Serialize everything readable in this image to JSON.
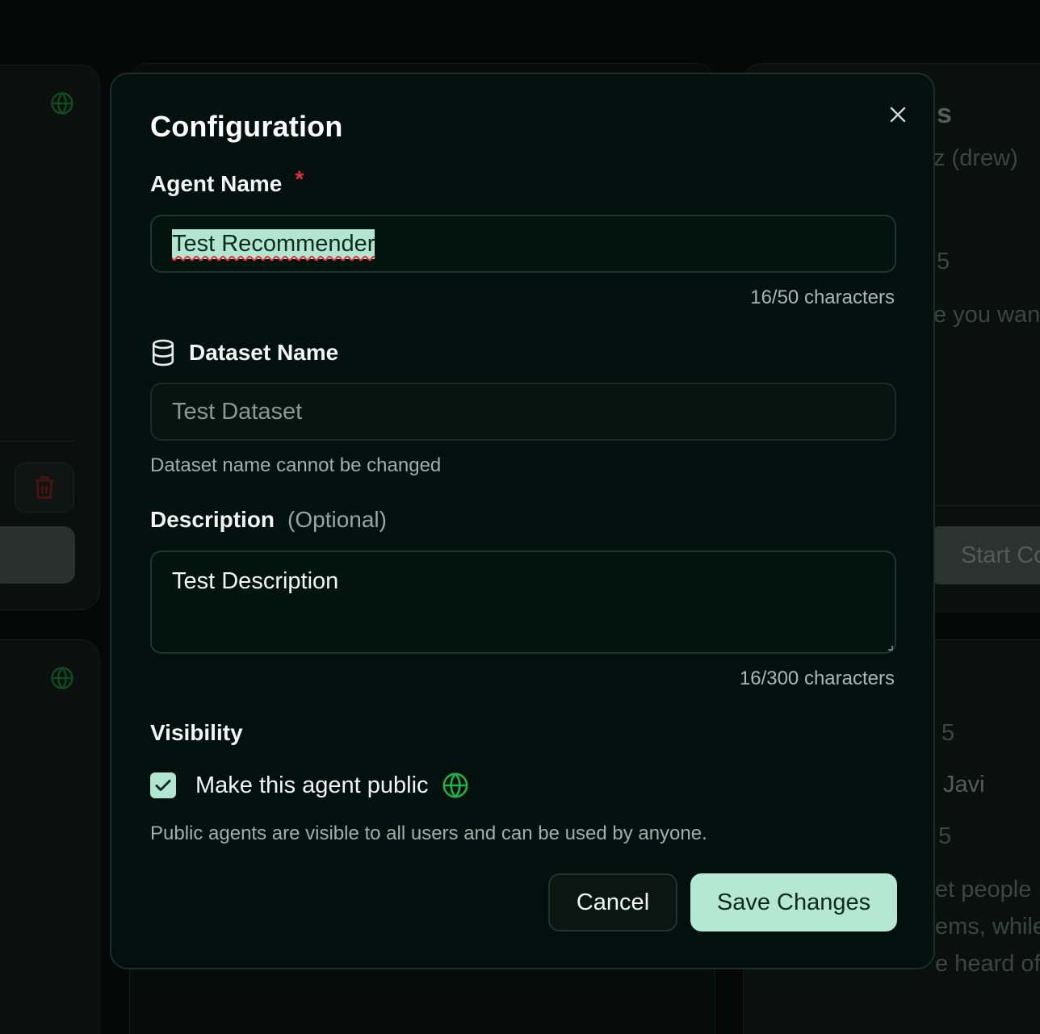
{
  "background": {
    "right_heading_fragment": "s",
    "right_author_fragment": "z (drew)",
    "right_count_1": "5",
    "right_text_1": "e you want",
    "right_button_label": "Start Co",
    "right_count_2": "5",
    "right_author_2": "Javi",
    "right_count_3": "5",
    "right_text_2": "et people",
    "right_text_3": "ems, while",
    "right_text_4": "e heard of"
  },
  "modal": {
    "title": "Configuration",
    "close_icon": "close-icon",
    "agent_name": {
      "label": "Agent Name",
      "required_mark": "*",
      "value": "Test Recommender",
      "counter": "16/50 characters"
    },
    "dataset_name": {
      "icon": "database-icon",
      "label": "Dataset Name",
      "value": "Test Dataset",
      "hint": "Dataset name cannot be changed"
    },
    "description": {
      "label": "Description",
      "optional_tag": "(Optional)",
      "value": "Test Description",
      "counter": "16/300 characters"
    },
    "visibility": {
      "label": "Visibility",
      "checkbox_label": "Make this agent public",
      "checked": true,
      "icon": "globe-icon",
      "hint": "Public agents are visible to all users and can be used by anyone."
    },
    "buttons": {
      "cancel": "Cancel",
      "save": "Save Changes"
    }
  },
  "colors": {
    "modal_bg": "#02110d",
    "accent": "#b5e8d4",
    "required": "#e0303a",
    "globe": "#1fb24b"
  }
}
